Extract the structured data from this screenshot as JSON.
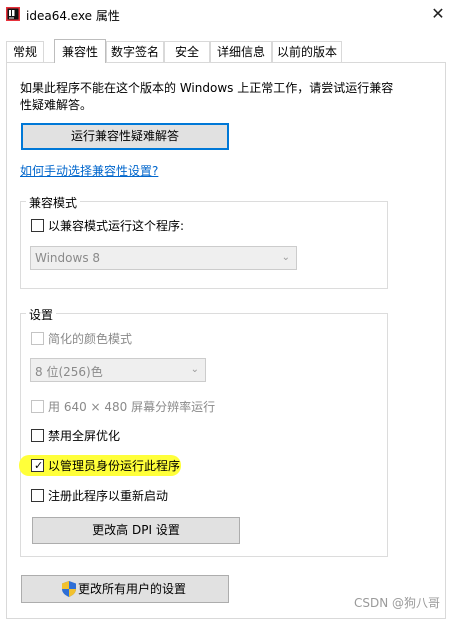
{
  "window": {
    "title": "idea64.exe 属性",
    "close_glyph": "✕"
  },
  "tabs": [
    {
      "label": "常规",
      "active": false
    },
    {
      "label": "兼容性",
      "active": true
    },
    {
      "label": "数字签名",
      "active": false
    },
    {
      "label": "安全",
      "active": false
    },
    {
      "label": "详细信息",
      "active": false
    },
    {
      "label": "以前的版本",
      "active": false
    }
  ],
  "intro": {
    "description": "如果此程序不能在这个版本的 Windows 上正常工作，请尝试运行兼容性疑难解答。",
    "troubleshooter_button": "运行兼容性疑难解答",
    "manual_link": "如何手动选择兼容性设置?"
  },
  "compat_mode": {
    "group_title": "兼容模式",
    "checkbox_label": "以兼容模式运行这个程序:",
    "checked": false,
    "os_select_value": "Windows 8"
  },
  "settings": {
    "group_title": "设置",
    "reduced_color": {
      "label": "简化的颜色模式",
      "checked": false,
      "disabled": true
    },
    "color_select_value": "8 位(256)色",
    "res_640": {
      "label": "用 640 × 480 屏幕分辨率运行",
      "checked": false,
      "disabled": true
    },
    "disable_fullscreen": {
      "label": "禁用全屏优化",
      "checked": false
    },
    "run_as_admin": {
      "label": "以管理员身份运行此程序",
      "checked": true
    },
    "register_restart": {
      "label": "注册此程序以重新启动",
      "checked": false
    },
    "dpi_button": "更改高 DPI 设置"
  },
  "all_users_button": "更改所有用户的设置",
  "watermark": "CSDN @狗八哥",
  "colors": {
    "highlight": "#ffff3a",
    "link": "#0066cc",
    "focus_border": "#0078d7"
  }
}
